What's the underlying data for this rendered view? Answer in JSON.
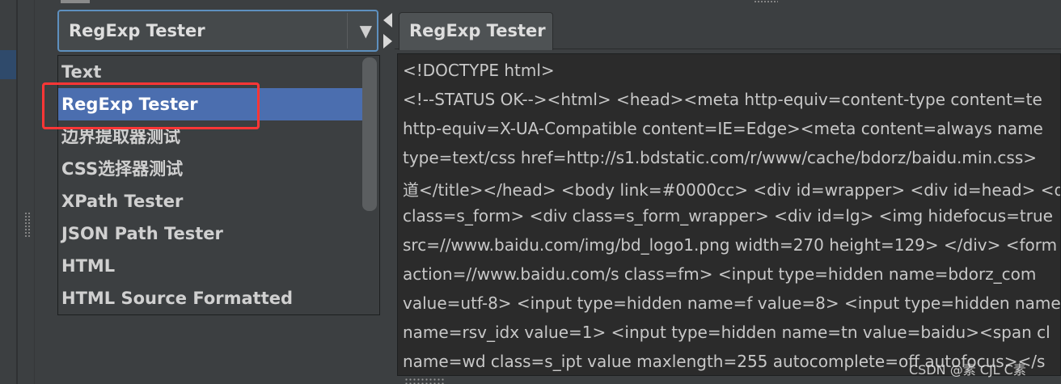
{
  "dropdown": {
    "selected": "RegExp Tester",
    "arrow": "▼"
  },
  "list": {
    "items": [
      "Text",
      "RegExp Tester",
      "边界提取器测试",
      "CSS选择器测试",
      "XPath Tester",
      "JSON Path Tester",
      "HTML",
      "HTML Source Formatted"
    ],
    "selected_index": 1
  },
  "tab": {
    "label": "RegExp Tester"
  },
  "response": {
    "lines": [
      "<!DOCTYPE html>",
      "<!--STATUS OK--><html> <head><meta http-equiv=content-type content=te",
      "http-equiv=X-UA-Compatible content=IE=Edge><meta content=always name",
      "type=text/css href=http://s1.bdstatic.com/r/www/cache/bdorz/baidu.min.css>",
      "道</title></head> <body link=#0000cc> <div id=wrapper> <div id=head> <div",
      "class=s_form> <div class=s_form_wrapper> <div id=lg> <img hidefocus=true",
      "src=//www.baidu.com/img/bd_logo1.png width=270 height=129> </div> <form",
      "action=//www.baidu.com/s class=fm> <input type=hidden name=bdorz_com",
      "value=utf-8> <input type=hidden name=f value=8> <input type=hidden name",
      "name=rsv_idx value=1> <input type=hidden name=tn value=baidu><span cl",
      "name=wd class=s_ipt value maxlength=255 autocomplete=off autofocus></s"
    ]
  },
  "watermark": "CSDN @素  CJL  C素",
  "colors": {
    "selection": "#4b6eaf",
    "highlight_box": "#ff3636",
    "focus_border": "#5e90bf"
  }
}
